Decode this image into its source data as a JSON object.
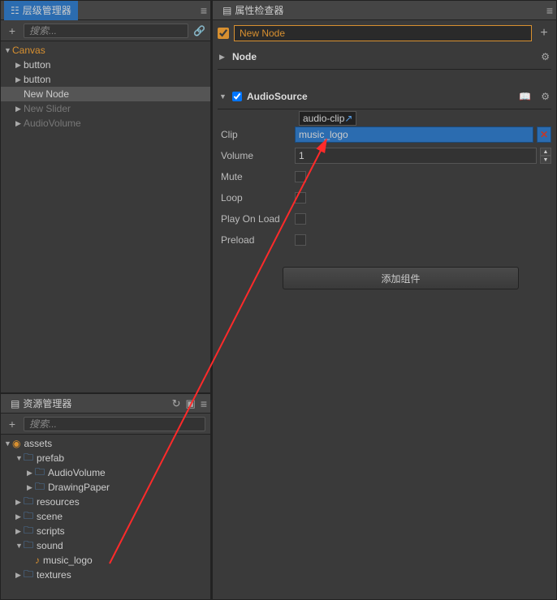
{
  "hierarchy": {
    "title": "层级管理器",
    "search_placeholder": "搜索...",
    "canvas": "Canvas",
    "items": [
      {
        "label": "button",
        "dim": false
      },
      {
        "label": "button",
        "dim": false
      },
      {
        "label": "New Node",
        "dim": false,
        "selected": true
      },
      {
        "label": "New Slider",
        "dim": true
      },
      {
        "label": "AudioVolume",
        "dim": true
      }
    ]
  },
  "assets": {
    "title": "资源管理器",
    "search_placeholder": "搜索...",
    "root": "assets",
    "tree": {
      "prefab": "prefab",
      "audio_volume": "AudioVolume",
      "drawing_paper": "DrawingPaper",
      "resources": "resources",
      "scene": "scene",
      "scripts": "scripts",
      "sound": "sound",
      "music_logo": "music_logo",
      "textures": "textures"
    }
  },
  "inspector": {
    "title": "属性检查器",
    "node_name": "New Node",
    "node_section": "Node",
    "audio_section": "AudioSource",
    "clip_label": "Clip",
    "clip_tag": "audio-clip",
    "clip_value": "music_logo",
    "volume_label": "Volume",
    "volume_value": "1",
    "mute_label": "Mute",
    "loop_label": "Loop",
    "play_label": "Play On Load",
    "preload_label": "Preload",
    "add_component": "添加组件"
  }
}
